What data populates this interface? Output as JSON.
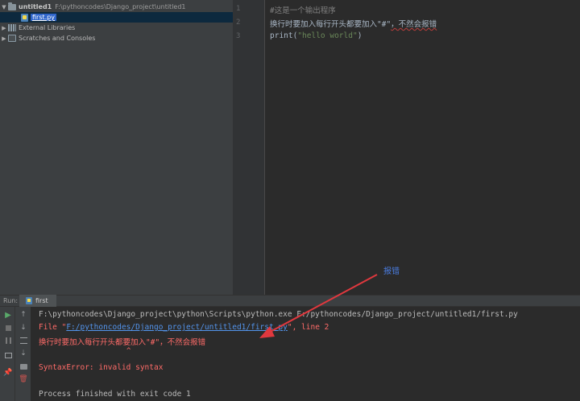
{
  "project": {
    "root_name": "untitled1",
    "root_path": "F:\\pythoncodes\\Django_project\\untitled1",
    "file_name": "first.py",
    "external_libraries": "External Libraries",
    "scratches": "Scratches and Consoles"
  },
  "editor": {
    "line_numbers": [
      "1",
      "2",
      "3"
    ],
    "line1": "#这是一个输出程序",
    "line2_text": "换行时要加入每行开头都要加入\"#\"",
    "line2_tail": "，不然会报错",
    "line3_fn": "print(",
    "line3_str": "\"hello world\"",
    "line3_close": ")"
  },
  "run": {
    "label": "Run:",
    "tab_name": "first",
    "console": {
      "cmd": "F:\\pythoncodes\\Django_project\\python\\Scripts\\python.exe F:/pythoncodes/Django_project/untitled1/first.py",
      "file_prefix": "  File \"",
      "file_link": "F:/pythoncodes/Django_project/untitled1/first.py",
      "file_suffix": "\", line 2",
      "error_source": "    换行时要加入每行开头都要加入\"#\"，不然会报错",
      "caret": "^",
      "error": "SyntaxError: invalid syntax",
      "exit": "Process finished with exit code 1"
    }
  },
  "annotation": {
    "label": "报错",
    "color": "#e0383e"
  }
}
